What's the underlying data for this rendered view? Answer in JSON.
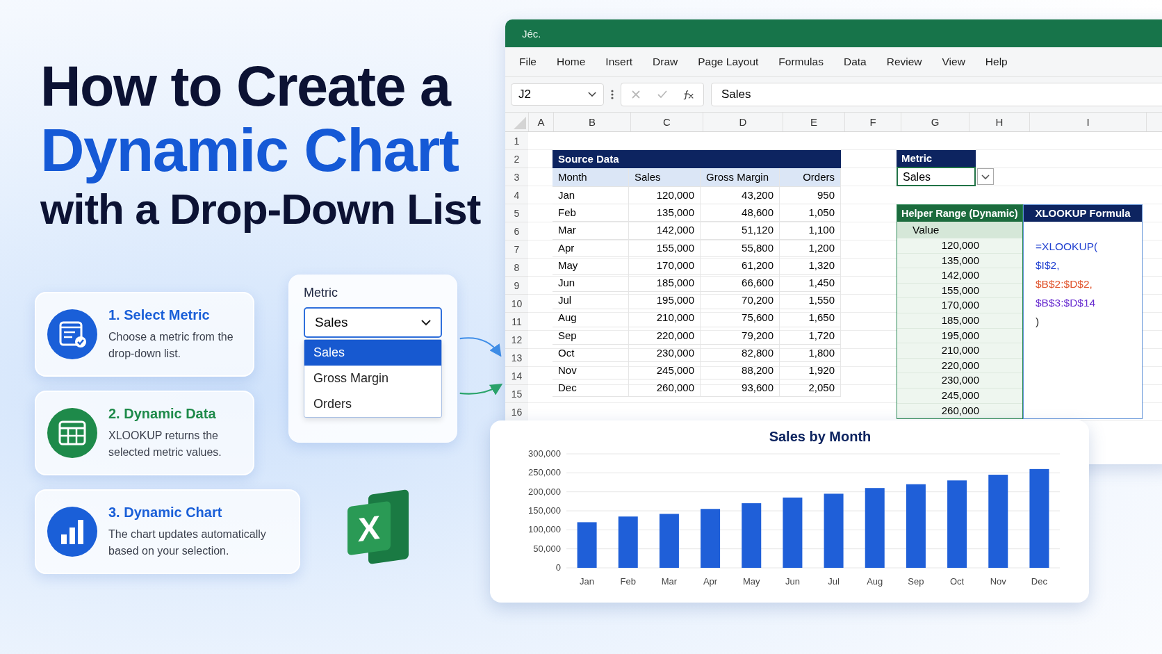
{
  "headline": {
    "line1": "How to Create a",
    "line2": "Dynamic Chart",
    "line3": "with a Drop-Down List"
  },
  "steps": [
    {
      "kind": "form",
      "color": "#1a5fd8",
      "title": "1. Select Metric",
      "text": "Choose a metric from the drop-down list."
    },
    {
      "kind": "table",
      "color": "#1e8a4a",
      "title": "2. Dynamic Data",
      "text": "XLOOKUP returns the selected metric values."
    },
    {
      "kind": "bars",
      "color": "#1a5fd8",
      "title": "3. Dynamic Chart",
      "text": "The chart updates automatically based on your selection."
    }
  ],
  "dropdown": {
    "label": "Metric",
    "value": "Sales",
    "options": [
      {
        "label": "Sales",
        "selected": true
      },
      {
        "label": "Gross Margin",
        "selected": false
      },
      {
        "label": "Orders",
        "selected": false
      }
    ]
  },
  "logo": {
    "letter": "X"
  },
  "excel": {
    "title": "Jéc.",
    "menu": [
      "File",
      "Home",
      "Insert",
      "Draw",
      "Page Layout",
      "Formulas",
      "Data",
      "Review",
      "View",
      "Help"
    ],
    "name_box": "J2",
    "formula": "Sales",
    "columns": [
      "A",
      "B",
      "C",
      "D",
      "E",
      "F",
      "G",
      "H",
      "I"
    ],
    "rows": [
      "1",
      "2",
      "3",
      "4",
      "5",
      "6",
      "7",
      "8",
      "9",
      "10",
      "11",
      "12",
      "13",
      "14",
      "15",
      "16"
    ],
    "source": {
      "title": "Source Data",
      "headers": [
        "Month",
        "Sales",
        "Gross Margin",
        "Orders"
      ],
      "rows": [
        [
          "Jan",
          "120,000",
          "43,200",
          "950"
        ],
        [
          "Feb",
          "135,000",
          "48,600",
          "1,050"
        ],
        [
          "Mar",
          "142,000",
          "51,120",
          "1,100"
        ],
        [
          "Apr",
          "155,000",
          "55,800",
          "1,200"
        ],
        [
          "May",
          "170,000",
          "61,200",
          "1,320"
        ],
        [
          "Jun",
          "185,000",
          "66,600",
          "1,450"
        ],
        [
          "Jul",
          "195,000",
          "70,200",
          "1,550"
        ],
        [
          "Aug",
          "210,000",
          "75,600",
          "1,650"
        ],
        [
          "Sep",
          "220,000",
          "79,200",
          "1,720"
        ],
        [
          "Oct",
          "230,000",
          "82,800",
          "1,800"
        ],
        [
          "Nov",
          "245,000",
          "88,200",
          "1,920"
        ],
        [
          "Dec",
          "260,000",
          "93,600",
          "2,050"
        ]
      ]
    },
    "metric": {
      "title": "Metric",
      "value": "Sales"
    },
    "helper": {
      "title": "Helper Range (Dynamic)",
      "header": "Value",
      "values": [
        "120,000",
        "135,000",
        "142,000",
        "155,000",
        "170,000",
        "185,000",
        "195,000",
        "210,000",
        "220,000",
        "230,000",
        "245,000",
        "260,000"
      ]
    },
    "formula_box": {
      "title": "XLOOKUP Formula",
      "lines": [
        {
          "text": "=XLOOKUP(",
          "color": "#1f3fd0"
        },
        {
          "text": "$I$2,",
          "color": "#1f3fd0"
        },
        {
          "text": "$B$2:$D$2,",
          "color": "#e0522a"
        },
        {
          "text": "$B$3:$D$14",
          "color": "#6a2fd0"
        },
        {
          "text": ")",
          "color": "#222222"
        }
      ]
    }
  },
  "chart": {
    "chart_data": {
      "type": "bar",
      "title": "Sales by Month",
      "categories": [
        "Jan",
        "Feb",
        "Mar",
        "Apr",
        "May",
        "Jun",
        "Jul",
        "Aug",
        "Sep",
        "Oct",
        "Nov",
        "Dec"
      ],
      "grid": true,
      "series": [
        {
          "color": "#1f5fd8",
          "values": [
            120000,
            135000,
            142000,
            155000,
            170000,
            185000,
            195000,
            210000,
            220000,
            230000,
            245000,
            260000
          ]
        }
      ],
      "ylim": [
        0,
        300000
      ],
      "yticks": [
        {
          "value": 0,
          "label": "0"
        },
        {
          "value": 50000,
          "label": "50,000"
        },
        {
          "value": 100000,
          "label": "100,000"
        },
        {
          "value": 150000,
          "label": "150,000"
        },
        {
          "value": 200000,
          "label": "200,000"
        },
        {
          "value": 250000,
          "label": "250,000"
        },
        {
          "value": 300000,
          "label": "300,000"
        }
      ]
    }
  }
}
